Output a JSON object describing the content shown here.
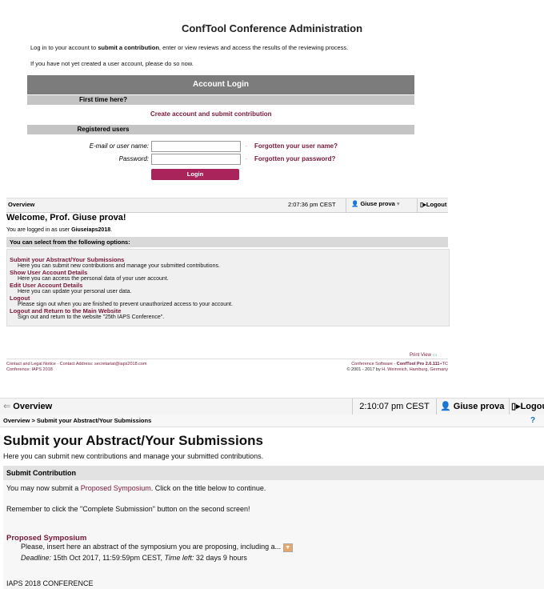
{
  "login_page": {
    "title": "ConfTool Conference Administration",
    "intro1_pre": "Log in to your account to ",
    "intro1_bold": "submit a contribution",
    "intro1_post": ", enter or view reviews and access the results of the reviewing process.",
    "intro2": "If you have not yet created a user account, please do so now.",
    "box_header": "Account Login",
    "first_time": "First time here?",
    "create_account": "Create account and submit contribution",
    "registered": "Registered users",
    "email_label": "E-mail or user name:",
    "password_label": "Password:",
    "forgot_user": "Forgotten your user name?",
    "forgot_pass": "Forgotten your password?",
    "login_button": "Login",
    "bullet": "·"
  },
  "overview_page": {
    "nav_label": "Overview",
    "time": "2:07:36 pm CEST",
    "user": "Giuse prova",
    "logout": "Logout",
    "welcome": "Welcome, Prof. Giuse prova!",
    "logged_pre": "You are logged in as user ",
    "logged_user": "Giuseiaps2018",
    "logged_post": ".",
    "options_header": "You can select from the following options:",
    "options": [
      {
        "label": "Submit your Abstract/Your Submissions",
        "desc": "Here you can submit new contributions and manage your submitted contributions."
      },
      {
        "label": "Show User Account Details",
        "desc": "Here you can access the personal data of your user account."
      },
      {
        "label": "Edit User Account Details",
        "desc": "Here you can update your personal user data."
      },
      {
        "label": "Logout",
        "desc": "Please sign out when you are finished to prevent unauthorized access to your account."
      },
      {
        "label": "Logout and Return to the Main Website",
        "desc": "Sign out and return to the website \"25th IAPS Conference\"."
      }
    ],
    "print_view": "Print View",
    "footer_contact": "Contact and Legal Notice · Contact Address: secretariat@iaps2018.com",
    "footer_conf": "Conference: IAPS 2018",
    "footer_soft_pre": "Conference Software - ",
    "footer_soft_bold": "ConfTool Pro 2.6.111",
    "footer_soft_post": "+TC",
    "footer_copy_pre": "© 2001 - 2017 by ",
    "footer_copy_link": "H. Weinreich, Hamburg, Germany"
  },
  "submit_page": {
    "nav_label": "Overview",
    "time": "2:10:07 pm CEST",
    "user": "Giuse prova",
    "logout": "Logout",
    "breadcrumb": "Overview > Submit your Abstract/Your Submissions",
    "title": "Submit your Abstract/Your Submissions",
    "intro": "Here you can submit new contributions and manage your submitted contributions.",
    "section_header": "Submit Contribution",
    "line1_pre": "You may now submit a ",
    "line1_link": "Proposed Symposium",
    "line1_post": ". Click on the title below to continue.",
    "line2": "Remember to click the \"Complete Submission\" button on the second screen!",
    "item_title": "Proposed Symposium",
    "item_desc": "Please, insert here an abstract of the symposium you are proposing, including a...",
    "deadline_label": "Deadline:",
    "deadline_value": " 15th Oct 2017, 11:59:59pm CEST, ",
    "time_left_label": "Time left:",
    "time_left_value": " 32 days 9 hours",
    "footer_label": "IAPS 2018 CONFERENCE"
  }
}
